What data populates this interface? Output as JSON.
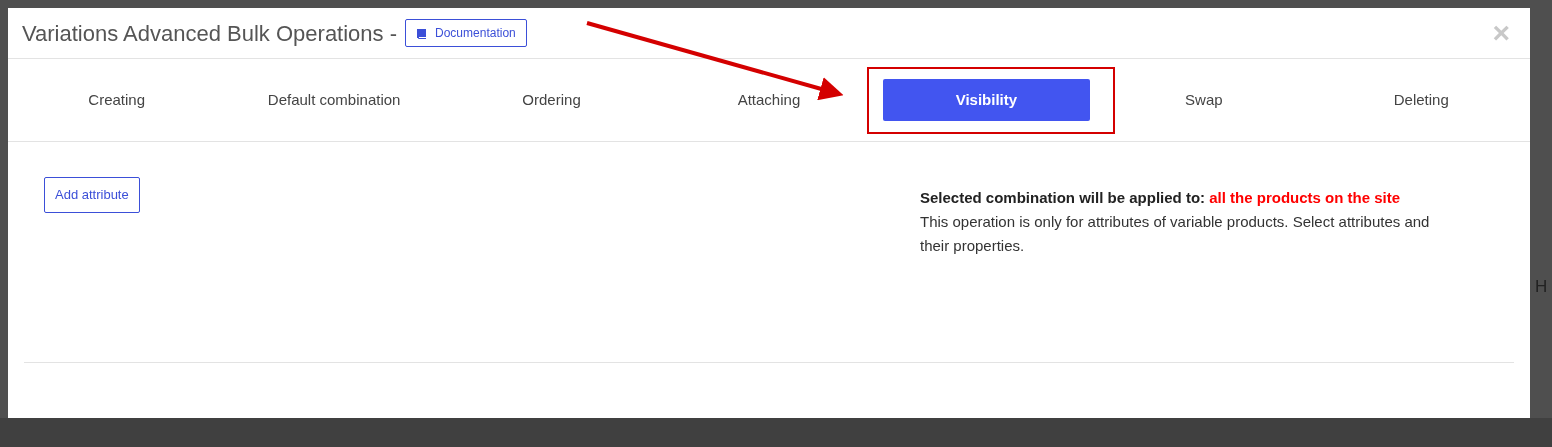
{
  "window": {
    "title": "Variations Advanced Bulk Operations -",
    "documentation_button": "Documentation",
    "close": "×"
  },
  "tabs": [
    {
      "label": "Creating",
      "selected": false
    },
    {
      "label": "Default combination",
      "selected": false
    },
    {
      "label": "Ordering",
      "selected": false
    },
    {
      "label": "Attaching",
      "selected": false
    },
    {
      "label": "Visibility",
      "selected": true
    },
    {
      "label": "Swap",
      "selected": false
    },
    {
      "label": "Deleting",
      "selected": false
    }
  ],
  "add_button": "Add attribute",
  "info": {
    "heading": "**Selected combination will be applied to:**",
    "target": "all the products on the site",
    "text": "This operation is only for attributes of variable products. Select attributes and their properties."
  },
  "background_text": "H"
}
